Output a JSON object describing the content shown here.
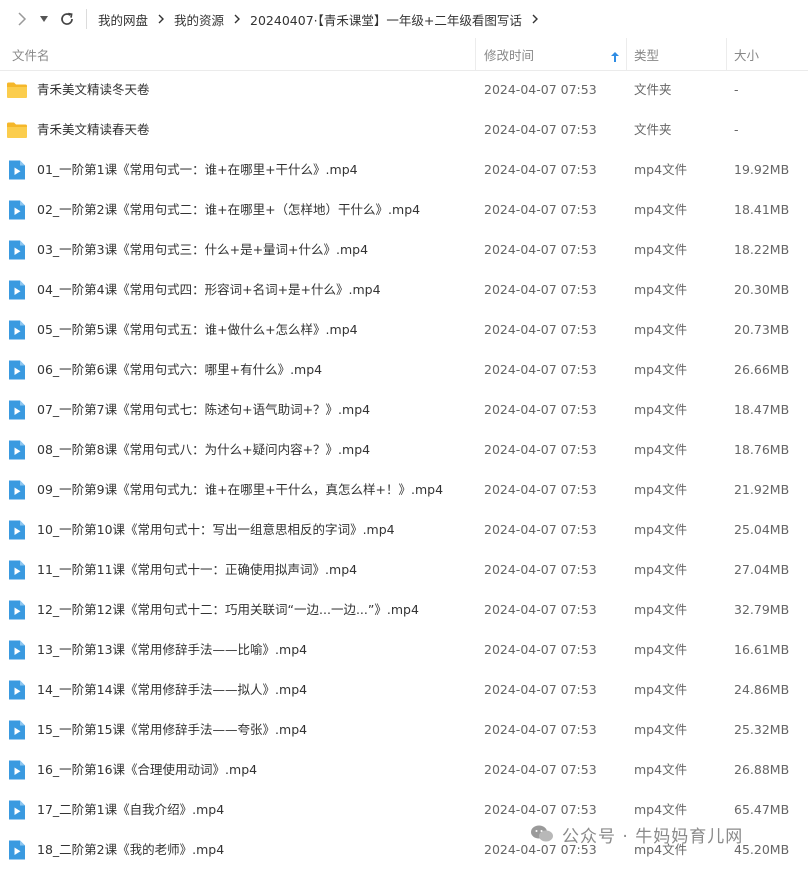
{
  "nav": {
    "breadcrumb": [
      "我的网盘",
      "我的资源",
      "20240407·【青禾课堂】一年级+二年级看图写话"
    ]
  },
  "columns": {
    "name": "文件名",
    "mtime": "修改时间",
    "type": "类型",
    "size": "大小"
  },
  "files": [
    {
      "name": "青禾美文精读冬天卷",
      "mtime": "2024-04-07 07:53",
      "type": "文件夹",
      "size": "-",
      "icon": "folder-icon"
    },
    {
      "name": "青禾美文精读春天卷",
      "mtime": "2024-04-07 07:53",
      "type": "文件夹",
      "size": "-",
      "icon": "folder-icon"
    },
    {
      "name": "01_一阶第1课《常用句式一：谁+在哪里+干什么》.mp4",
      "mtime": "2024-04-07 07:53",
      "type": "mp4文件",
      "size": "19.92MB",
      "icon": "video-file-icon"
    },
    {
      "name": "02_一阶第2课《常用句式二：谁+在哪里+（怎样地）干什么》.mp4",
      "mtime": "2024-04-07 07:53",
      "type": "mp4文件",
      "size": "18.41MB",
      "icon": "video-file-icon"
    },
    {
      "name": "03_一阶第3课《常用句式三：什么+是+量词+什么》.mp4",
      "mtime": "2024-04-07 07:53",
      "type": "mp4文件",
      "size": "18.22MB",
      "icon": "video-file-icon"
    },
    {
      "name": "04_一阶第4课《常用句式四：形容词+名词+是+什么》.mp4",
      "mtime": "2024-04-07 07:53",
      "type": "mp4文件",
      "size": "20.30MB",
      "icon": "video-file-icon"
    },
    {
      "name": "05_一阶第5课《常用句式五：谁+做什么+怎么样》.mp4",
      "mtime": "2024-04-07 07:53",
      "type": "mp4文件",
      "size": "20.73MB",
      "icon": "video-file-icon"
    },
    {
      "name": "06_一阶第6课《常用句式六：哪里+有什么》.mp4",
      "mtime": "2024-04-07 07:53",
      "type": "mp4文件",
      "size": "26.66MB",
      "icon": "video-file-icon"
    },
    {
      "name": "07_一阶第7课《常用句式七：陈述句+语气助词+？》.mp4",
      "mtime": "2024-04-07 07:53",
      "type": "mp4文件",
      "size": "18.47MB",
      "icon": "video-file-icon"
    },
    {
      "name": "08_一阶第8课《常用句式八：为什么+疑问内容+？》.mp4",
      "mtime": "2024-04-07 07:53",
      "type": "mp4文件",
      "size": "18.76MB",
      "icon": "video-file-icon"
    },
    {
      "name": "09_一阶第9课《常用句式九：谁+在哪里+干什么，真怎么样+！》.mp4",
      "mtime": "2024-04-07 07:53",
      "type": "mp4文件",
      "size": "21.92MB",
      "icon": "video-file-icon"
    },
    {
      "name": "10_一阶第10课《常用句式十：写出一组意思相反的字词》.mp4",
      "mtime": "2024-04-07 07:53",
      "type": "mp4文件",
      "size": "25.04MB",
      "icon": "video-file-icon"
    },
    {
      "name": "11_一阶第11课《常用句式十一：正确使用拟声词》.mp4",
      "mtime": "2024-04-07 07:53",
      "type": "mp4文件",
      "size": "27.04MB",
      "icon": "video-file-icon"
    },
    {
      "name": "12_一阶第12课《常用句式十二：巧用关联词“一边...一边...”》.mp4",
      "mtime": "2024-04-07 07:53",
      "type": "mp4文件",
      "size": "32.79MB",
      "icon": "video-file-icon"
    },
    {
      "name": "13_一阶第13课《常用修辞手法——比喻》.mp4",
      "mtime": "2024-04-07 07:53",
      "type": "mp4文件",
      "size": "16.61MB",
      "icon": "video-file-icon"
    },
    {
      "name": "14_一阶第14课《常用修辞手法——拟人》.mp4",
      "mtime": "2024-04-07 07:53",
      "type": "mp4文件",
      "size": "24.86MB",
      "icon": "video-file-icon"
    },
    {
      "name": "15_一阶第15课《常用修辞手法——夸张》.mp4",
      "mtime": "2024-04-07 07:53",
      "type": "mp4文件",
      "size": "25.32MB",
      "icon": "video-file-icon"
    },
    {
      "name": "16_一阶第16课《合理使用动词》.mp4",
      "mtime": "2024-04-07 07:53",
      "type": "mp4文件",
      "size": "26.88MB",
      "icon": "video-file-icon"
    },
    {
      "name": "17_二阶第1课《自我介绍》.mp4",
      "mtime": "2024-04-07 07:53",
      "type": "mp4文件",
      "size": "65.47MB",
      "icon": "video-file-icon"
    },
    {
      "name": "18_二阶第2课《我的老师》.mp4",
      "mtime": "2024-04-07 07:53",
      "type": "mp4文件",
      "size": "45.20MB",
      "icon": "video-file-icon"
    }
  ],
  "watermark": "公众号 · 牛妈妈育儿网",
  "colors": {
    "folder": "#f7c33e",
    "video": "#3a9ae0",
    "header_text": "#888888",
    "sort_arrow": "#2f8de4"
  }
}
